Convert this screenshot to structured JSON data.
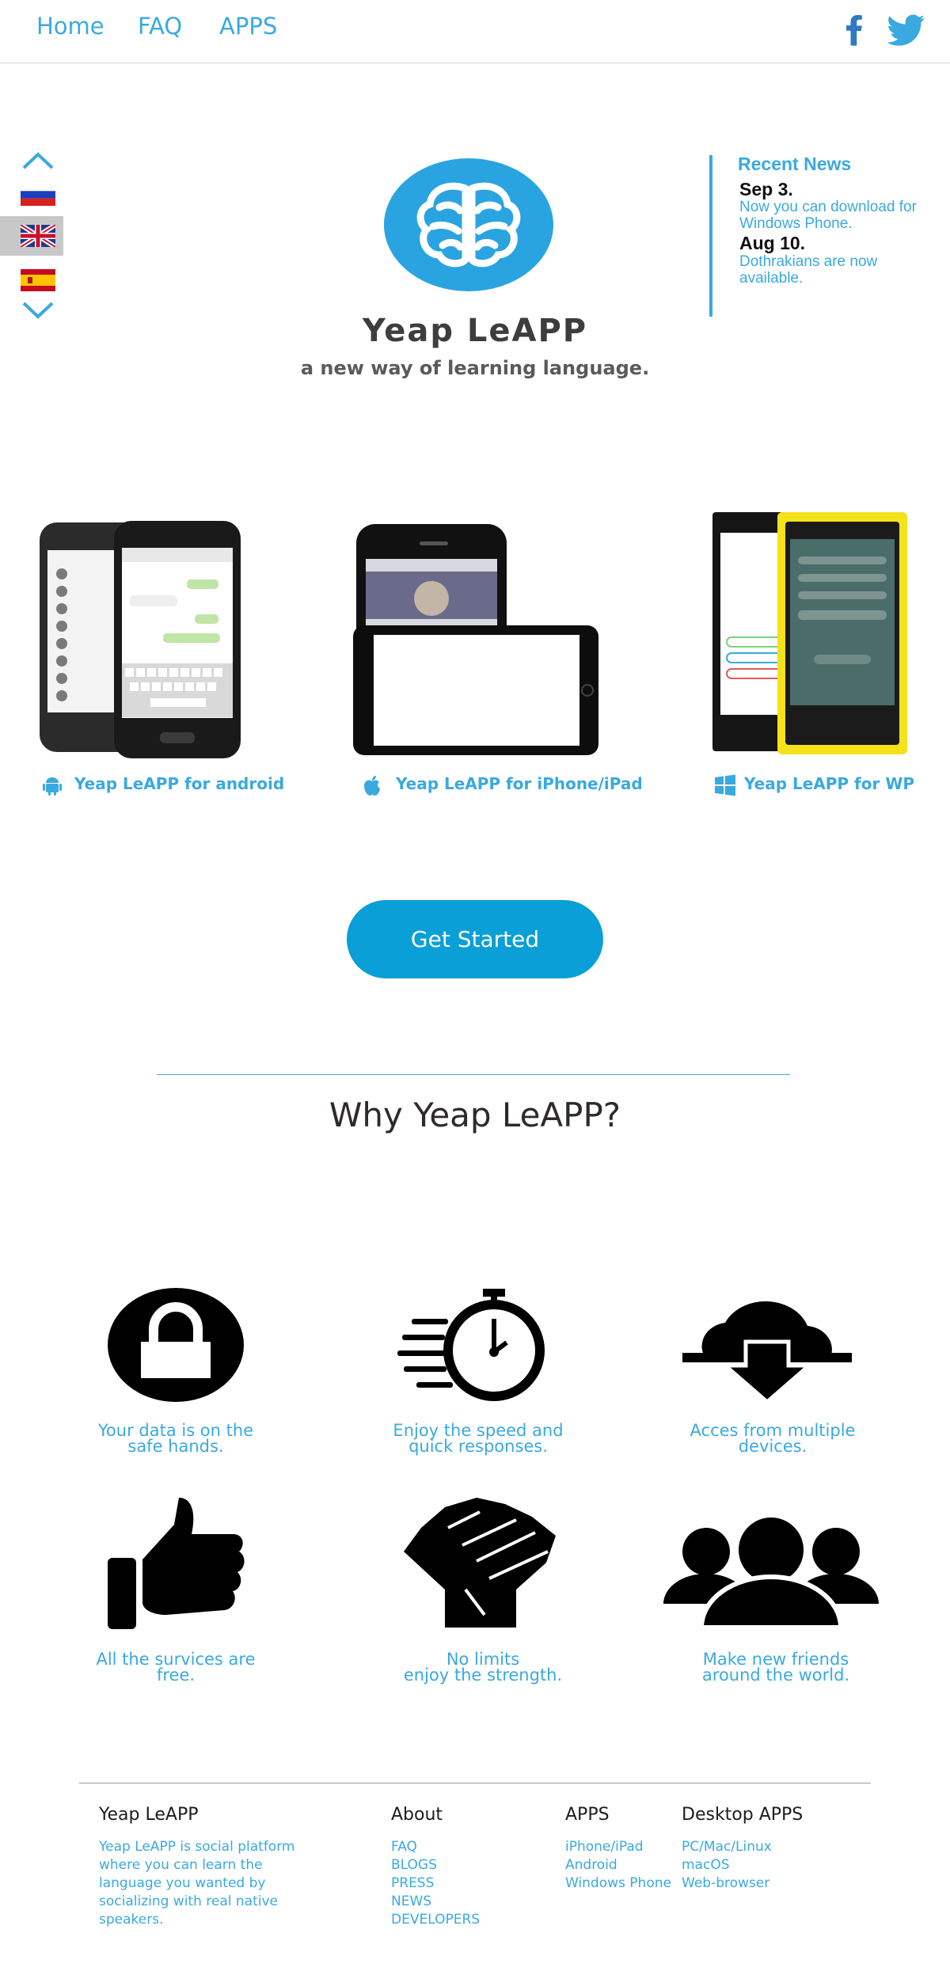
{
  "nav": {
    "home": "Home",
    "faq": "FAQ",
    "apps": "APPS"
  },
  "social": {
    "facebook_icon": "facebook-icon",
    "twitter_icon": "twitter-icon",
    "facebook_color": "#2f78c4",
    "twitter_color": "#3aa9e0"
  },
  "languages": {
    "items": [
      "ru",
      "en",
      "es"
    ],
    "selected": "en"
  },
  "hero": {
    "title": "Yeap LeAPP",
    "tagline": "a new way of learning language.",
    "logo_color": "#2aa4e0"
  },
  "news": {
    "heading": "Recent News",
    "items": [
      {
        "date": "Sep 3.",
        "text": "Now you can download for Windows Phone."
      },
      {
        "date": "Aug 10.",
        "text": "Dothrakians are now available."
      }
    ]
  },
  "apps": [
    {
      "label": "Yeap LeAPP for android",
      "icon": "android-icon"
    },
    {
      "label": "Yeap LeAPP for iPhone/iPad",
      "icon": "apple-icon"
    },
    {
      "label": "Yeap LeAPP for WP",
      "icon": "windows-icon"
    }
  ],
  "cta": {
    "label": "Get Started",
    "color": "#0a9fd6"
  },
  "why": {
    "heading": "Why Yeap LeAPP?"
  },
  "features": [
    {
      "line1": "Your data is on the",
      "line2": "safe hands.",
      "icon": "lock-icon"
    },
    {
      "line1": "Enjoy the speed and",
      "line2": "quick responses.",
      "icon": "stopwatch-icon"
    },
    {
      "line1": "Acces from multiple",
      "line2": "devices.",
      "icon": "cloud-download-icon"
    },
    {
      "line1": "All the survices are",
      "line2": "free.",
      "icon": "thumbs-up-icon"
    },
    {
      "line1": "No limits",
      "line2": "enjoy the strength.",
      "icon": "fist-icon"
    },
    {
      "line1": "Make new friends",
      "line2": "around the world.",
      "icon": "people-icon"
    }
  ],
  "footer": {
    "brand_heading": "Yeap LeAPP",
    "brand_text": "Yeap LeAPP is social platform where you can learn the language you wanted by socializing with real native speakers.",
    "about_heading": "About",
    "about_links": [
      "FAQ",
      "BLOGS",
      "PRESS",
      "NEWS",
      "DEVELOPERS"
    ],
    "apps_heading": "APPS",
    "apps_links": [
      "iPhone/iPad",
      "Android",
      "Windows Phone"
    ],
    "desktop_heading": "Desktop APPS",
    "desktop_links": [
      "PC/Mac/Linux",
      "macOS",
      "Web-browser"
    ]
  }
}
